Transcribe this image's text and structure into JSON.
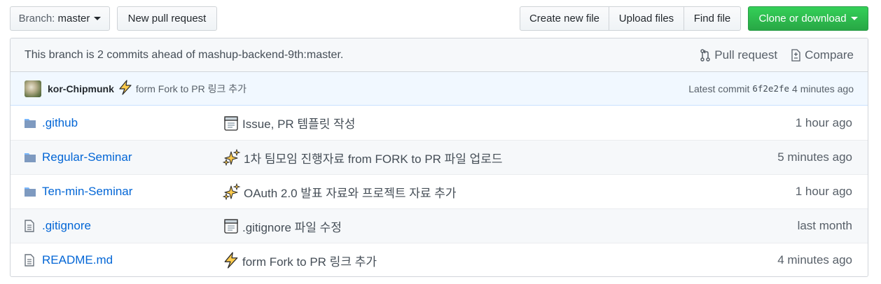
{
  "toolbar": {
    "branch_label": "Branch:",
    "branch_value": "master",
    "new_pull_request": "New pull request",
    "create_new_file": "Create new file",
    "upload_files": "Upload files",
    "find_file": "Find file",
    "clone_or_download": "Clone or download"
  },
  "ahead_bar": {
    "message": "This branch is 2 commits ahead of mashup-backend-9th:master.",
    "pull_request": "Pull request",
    "compare": "Compare"
  },
  "latest_commit": {
    "author": "kor-Chipmunk",
    "emoji": "zap-icon",
    "message": "form Fork to PR 링크 추가",
    "latest_label": "Latest commit",
    "sha": "6f2e2fe",
    "age": "4 minutes ago"
  },
  "files": [
    {
      "type": "folder",
      "name": ".github",
      "emoji": "memo-icon",
      "message": "Issue, PR 템플릿 작성",
      "age": "1 hour ago"
    },
    {
      "type": "folder",
      "name": "Regular-Seminar",
      "emoji": "sparkles-icon",
      "message": "1차 팀모임 진행자료 from FORK to PR 파일 업로드",
      "age": "5 minutes ago"
    },
    {
      "type": "folder",
      "name": "Ten-min-Seminar",
      "emoji": "sparkles-icon",
      "message": "OAuth 2.0 발표 자료와 프로젝트 자료 추가",
      "age": "1 hour ago"
    },
    {
      "type": "file",
      "name": ".gitignore",
      "emoji": "memo-icon",
      "message": ".gitignore 파일 수정",
      "age": "last month"
    },
    {
      "type": "file",
      "name": "README.md",
      "emoji": "zap-icon",
      "message": "form Fork to PR 링크 추가",
      "age": "4 minutes ago"
    }
  ],
  "colors": {
    "link": "#0366d6",
    "clone_button": "#28a745",
    "commit_bar": "#f1f8ff"
  }
}
